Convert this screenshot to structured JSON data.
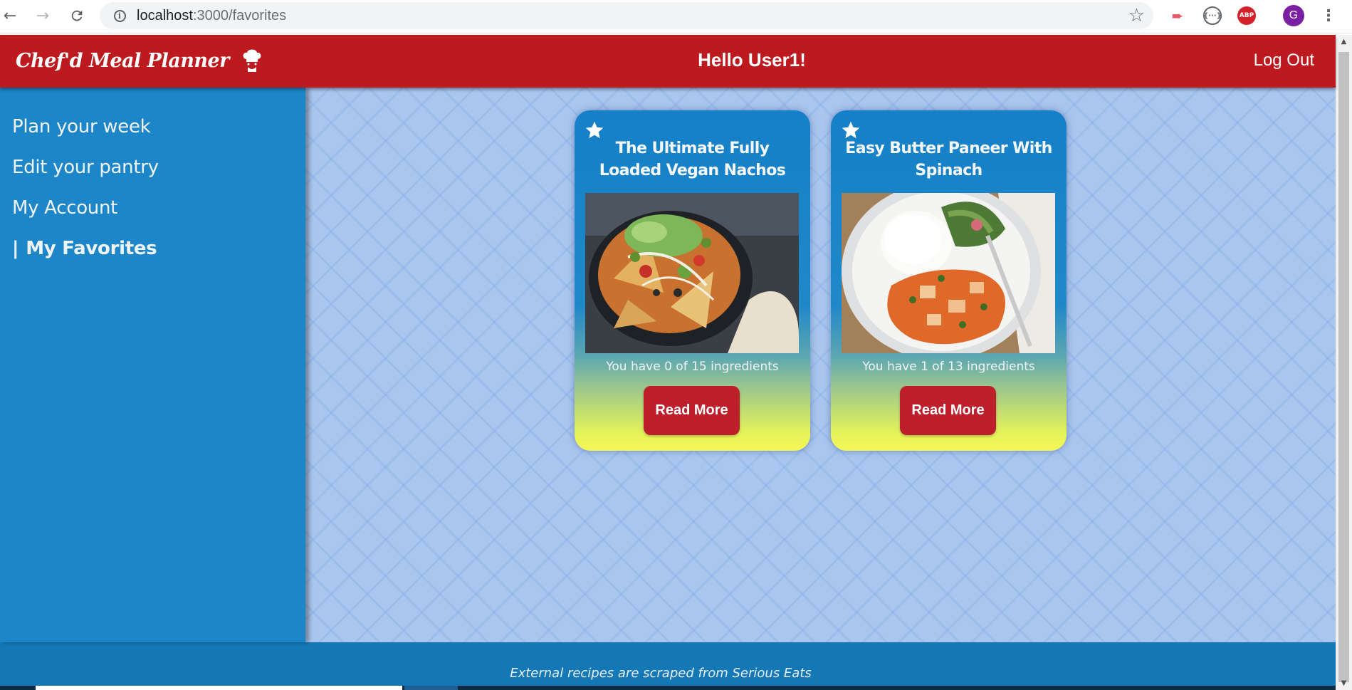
{
  "browser": {
    "url_host": "localhost",
    "url_path": ":3000/favorites",
    "profile_initial": "G",
    "extension_abp": "ABP",
    "extension_code": "{···}"
  },
  "header": {
    "brand": "Chef'd Meal Planner",
    "greeting": "Hello User1!",
    "logout": "Log Out",
    "color": "#bd1a1f"
  },
  "sidebar": {
    "color": "#1d86c9",
    "items": [
      {
        "label": "Plan your week",
        "active": false
      },
      {
        "label": "Edit your pantry",
        "active": false
      },
      {
        "label": "My Account",
        "active": false
      },
      {
        "label": "My Favorites",
        "active": true,
        "marker": "|"
      }
    ]
  },
  "recipes": [
    {
      "title": "The Ultimate Fully Loaded Vegan Nachos",
      "ingredients_text": "You have 0 of 15 ingredients",
      "button": "Read More",
      "favorite": true,
      "image_icon": "nachos-image"
    },
    {
      "title": "Easy Butter Paneer With Spinach",
      "ingredients_text": "You have 1 of 13 ingredients",
      "button": "Read More",
      "favorite": true,
      "image_icon": "paneer-image"
    }
  ],
  "footer": {
    "text": "External recipes are scraped from Serious Eats"
  }
}
